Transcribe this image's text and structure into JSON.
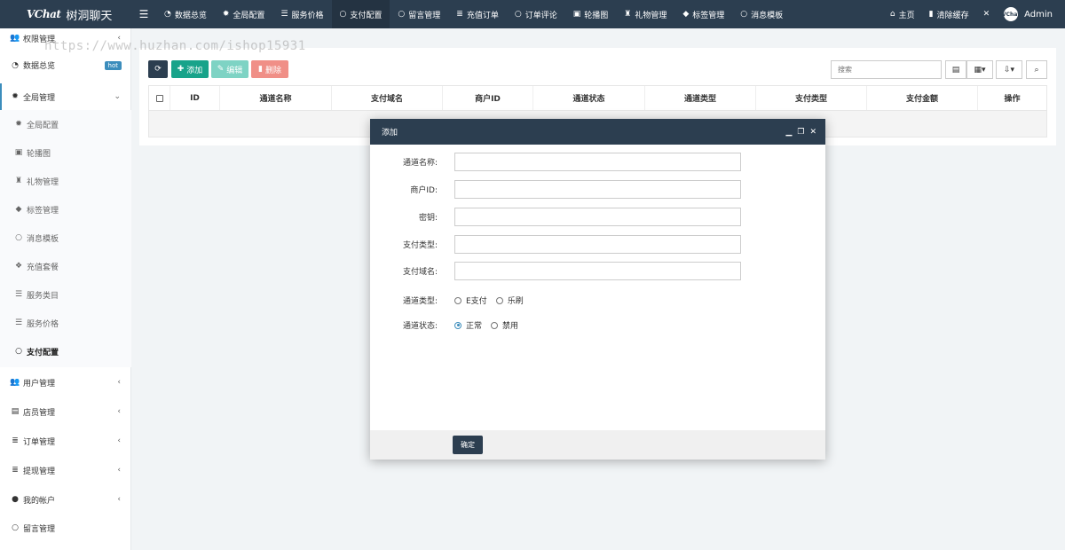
{
  "brand": {
    "logo_text": "VChat",
    "name": "树洞聊天"
  },
  "topnav": {
    "menu_icon": "bars-icon",
    "items": [
      {
        "label": "数据总览",
        "icon": "dashboard-icon"
      },
      {
        "label": "全局配置",
        "icon": "gear-icon"
      },
      {
        "label": "服务价格",
        "icon": "list-icon"
      },
      {
        "label": "支付配置",
        "icon": "circle-icon",
        "active": true
      },
      {
        "label": "留言管理",
        "icon": "circle-icon"
      },
      {
        "label": "充值订单",
        "icon": "database-icon"
      },
      {
        "label": "订单评论",
        "icon": "circle-icon"
      },
      {
        "label": "轮播图",
        "icon": "image-icon"
      },
      {
        "label": "礼物管理",
        "icon": "gift-icon"
      },
      {
        "label": "标签管理",
        "icon": "tag-icon"
      },
      {
        "label": "消息模板",
        "icon": "circle-icon"
      }
    ],
    "right": {
      "home": "主页",
      "clear_cache": "清除缓存",
      "avatar_text": "VChat",
      "user": "Admin"
    }
  },
  "sidebar": {
    "items": [
      {
        "label": "权限管理",
        "icon": "users-icon"
      },
      {
        "label": "数据总览",
        "icon": "dashboard-icon",
        "badge": "hot"
      },
      {
        "label": "全局管理",
        "icon": "gears-icon"
      },
      {
        "label": "全局配置",
        "icon": "gear-icon"
      },
      {
        "label": "轮播图",
        "icon": "image-icon"
      },
      {
        "label": "礼物管理",
        "icon": "gift-icon"
      },
      {
        "label": "标签管理",
        "icon": "tags-icon"
      },
      {
        "label": "消息模板",
        "icon": "circle-icon"
      },
      {
        "label": "充值套餐",
        "icon": "cubes-icon"
      },
      {
        "label": "服务类目",
        "icon": "list-icon"
      },
      {
        "label": "服务价格",
        "icon": "list-icon"
      },
      {
        "label": "支付配置",
        "icon": "circle-icon"
      },
      {
        "label": "用户管理",
        "icon": "users-icon"
      },
      {
        "label": "店员管理",
        "icon": "id-card-icon"
      },
      {
        "label": "订单管理",
        "icon": "database-icon"
      },
      {
        "label": "提现管理",
        "icon": "database-icon"
      },
      {
        "label": "我的帐户",
        "icon": "user-icon"
      },
      {
        "label": "留言管理",
        "icon": "circle-icon"
      }
    ]
  },
  "toolbar": {
    "add": "添加",
    "edit": "编辑",
    "delete": "删除",
    "search_placeholder": "搜索"
  },
  "table": {
    "columns": [
      "ID",
      "通道名称",
      "支付域名",
      "商户ID",
      "通道状态",
      "通道类型",
      "支付类型",
      "支付金额",
      "操作"
    ]
  },
  "modal": {
    "title": "添加",
    "fields": {
      "channel_name": "通道名称:",
      "merchant_id": "商户ID:",
      "secret_key": "密钥:",
      "pay_type": "支付类型:",
      "pay_domain": "支付域名:"
    },
    "channel_type": {
      "label": "通道类型:",
      "options": [
        "E支付",
        "乐刷"
      ]
    },
    "channel_status": {
      "label": "通道状态:",
      "options": [
        "正常",
        "禁用"
      ],
      "selected": "正常"
    },
    "confirm": "确定"
  },
  "watermark": "https://www.huzhan.com/ishop15931",
  "colors": {
    "header": "#2c3e50",
    "add": "#18a38a",
    "edit": "#7ed3c4",
    "delete": "#f08f87",
    "accent": "#3c8dbc"
  }
}
